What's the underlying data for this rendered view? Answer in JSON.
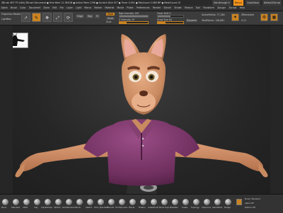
{
  "window": {
    "title": "ZBrush 4R7 P3 (x64)   ZBrush Document   ● Free Mem 11.361GB   ● Active Mem 1296   ● Scratch Disk 977   ● Timer 0.001   ● PolyCount 0.069 MP   ● MeshCount 15",
    "quicksave": "QuickSave",
    "see_through": "See-through 0",
    "menus_btn": "Menus",
    "default_script": "DefaultZScript"
  },
  "menubar": {
    "items": [
      "Alpha",
      "Brush",
      "Color",
      "Document",
      "Draw",
      "Edit",
      "File",
      "Layer",
      "Light",
      "Macro",
      "Marker",
      "Material",
      "Movie",
      "Picker",
      "Preferences",
      "Render",
      "Stencil",
      "Stroke",
      "Texture",
      "Tool",
      "Transform",
      "Zplugin",
      "Zscript",
      "Help"
    ]
  },
  "toolbar": {
    "projection": "Projection Master",
    "lightbox": "LightBox",
    "edit": "Edit",
    "draw": "Draw",
    "move": "Move",
    "scale": "Scale",
    "rotate": "Rotate",
    "mrgb": "Mrgb",
    "rgb": "Rgb",
    "m": "M",
    "zadd": "Zadd",
    "zsub": "Zsub",
    "zcut": "Zcut",
    "rgb_intensity": "Rgb Intensity 100",
    "z_intensity": "Z Intensity 25",
    "focal_shift": "Focal Shift 0",
    "draw_size": "Draw Size 64",
    "dynamic": "Dynamic",
    "active_points": "ActivePoints: 77,264",
    "total_points": "TotalPoints: 128,861",
    "zremesher": "ZRemesher",
    "zremesher_val": "0.21",
    "icons": [
      "↗",
      "✎",
      "✥",
      "⤢",
      "⟳"
    ]
  },
  "bottombar": {
    "brushes": [
      "Move",
      "Standard",
      "Inflat",
      "Clay",
      "ClayBuildup",
      "hPolish",
      "DamStandard",
      "Pinch",
      "Slash3",
      "Dam_Standard",
      "Smooth",
      "TrimDynamic",
      "Planar",
      "Flatten",
      "SnakeHook",
      "Move Topo",
      "MaskPen",
      "Snake",
      "Topology",
      "ClipCurve",
      "SelectRect",
      "Nudge",
      "Layer"
    ],
    "right_label": "Brush: Standard",
    "right_label2": "Alpha Off",
    "right_label3": "Texture Off"
  },
  "colors": {
    "accent": "#c98320",
    "skin": "#d99a73",
    "shirt": "#7a3a68",
    "pants": "#3a3a3a",
    "background": "#262626"
  }
}
